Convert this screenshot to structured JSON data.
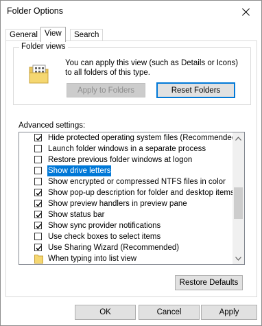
{
  "window": {
    "title": "Folder Options"
  },
  "tabs": [
    {
      "label": "General",
      "active": false
    },
    {
      "label": "View",
      "active": true
    },
    {
      "label": "Search",
      "active": false
    }
  ],
  "folder_views": {
    "group_label": "Folder views",
    "description": "You can apply this view (such as Details or Icons) to all folders of this type.",
    "apply_button": "Apply to Folders",
    "reset_button": "Reset Folders"
  },
  "advanced": {
    "label": "Advanced settings:",
    "items": [
      {
        "label": "Hide protected operating system files (Recommended)",
        "type": "checkbox",
        "checked": true,
        "selected": false
      },
      {
        "label": "Launch folder windows in a separate process",
        "type": "checkbox",
        "checked": false,
        "selected": false
      },
      {
        "label": "Restore previous folder windows at logon",
        "type": "checkbox",
        "checked": false,
        "selected": false
      },
      {
        "label": "Show drive letters",
        "type": "checkbox",
        "checked": false,
        "selected": true
      },
      {
        "label": "Show encrypted or compressed NTFS files in color",
        "type": "checkbox",
        "checked": false,
        "selected": false
      },
      {
        "label": "Show pop-up description for folder and desktop items",
        "type": "checkbox",
        "checked": true,
        "selected": false
      },
      {
        "label": "Show preview handlers in preview pane",
        "type": "checkbox",
        "checked": true,
        "selected": false
      },
      {
        "label": "Show status bar",
        "type": "checkbox",
        "checked": true,
        "selected": false
      },
      {
        "label": "Show sync provider notifications",
        "type": "checkbox",
        "checked": true,
        "selected": false
      },
      {
        "label": "Use check boxes to select items",
        "type": "checkbox",
        "checked": false,
        "selected": false
      },
      {
        "label": "Use Sharing Wizard (Recommended)",
        "type": "checkbox",
        "checked": true,
        "selected": false
      },
      {
        "label": "When typing into list view",
        "type": "folder",
        "checked": false,
        "selected": false
      }
    ],
    "restore_button": "Restore Defaults"
  },
  "footer": {
    "ok": "OK",
    "cancel": "Cancel",
    "apply": "Apply"
  },
  "colors": {
    "accent": "#0078d7",
    "button_face": "#e1e1e1",
    "border": "#adadad"
  }
}
